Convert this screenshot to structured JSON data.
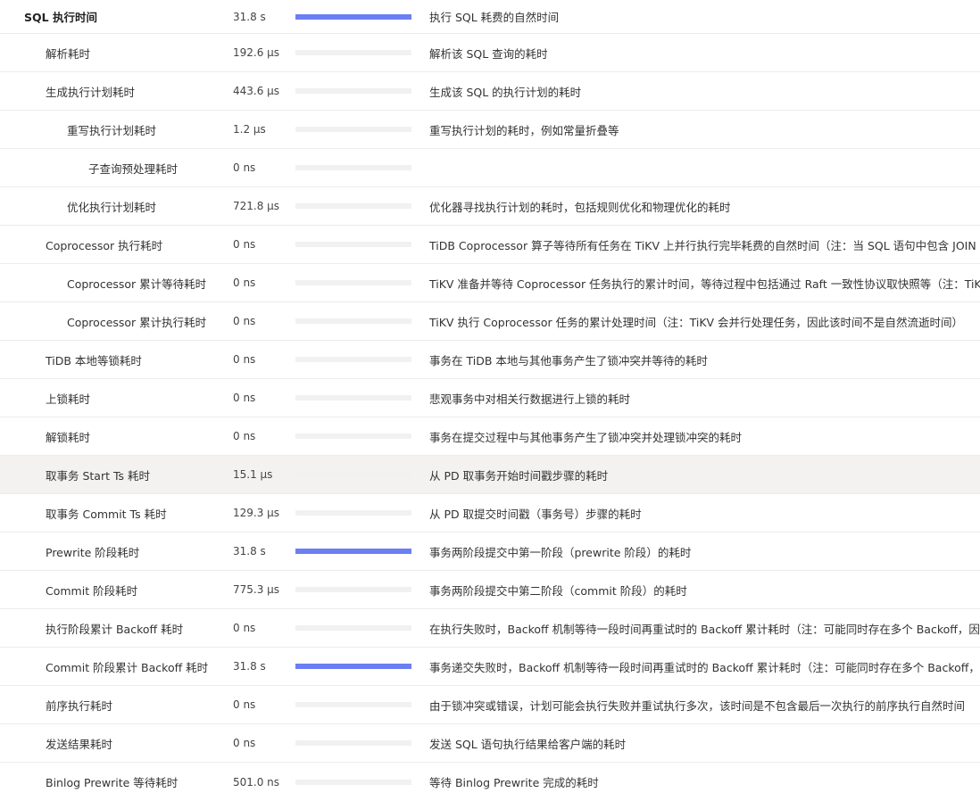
{
  "bar_color": "#6b7ff3",
  "track_color": "#f1f1f1",
  "highlight_color": "#f3f2f1",
  "rows": [
    {
      "name": "SQL 执行时间",
      "indent": 0,
      "value": "31.8 s",
      "fill": 1.0,
      "desc": "执行 SQL 耗费的自然时间"
    },
    {
      "name": "解析耗时",
      "indent": 1,
      "value": "192.6 µs",
      "fill": 0.0,
      "desc": "解析该 SQL 查询的耗时"
    },
    {
      "name": "生成执行计划耗时",
      "indent": 1,
      "value": "443.6 µs",
      "fill": 0.0,
      "desc": "生成该 SQL 的执行计划的耗时"
    },
    {
      "name": "重写执行计划耗时",
      "indent": 2,
      "value": "1.2 µs",
      "fill": 0.0,
      "desc": "重写执行计划的耗时，例如常量折叠等"
    },
    {
      "name": "子查询预处理耗时",
      "indent": 3,
      "value": "0 ns",
      "fill": 0.0,
      "desc": ""
    },
    {
      "name": "优化执行计划耗时",
      "indent": 2,
      "value": "721.8 µs",
      "fill": 0.0,
      "desc": "优化器寻找执行计划的耗时，包括规则优化和物理优化的耗时"
    },
    {
      "name": "Coprocessor 执行耗时",
      "indent": 1,
      "value": "0 ns",
      "fill": 0.0,
      "desc": "TiDB Coprocessor 算子等待所有任务在 TiKV 上并行执行完毕耗费的自然时间（注：当 SQL 语句中包含 JOIN 时"
    },
    {
      "name": "Coprocessor 累计等待耗时",
      "indent": 2,
      "value": "0 ns",
      "fill": 0.0,
      "desc": "TiKV 准备并等待 Coprocessor 任务执行的累计时间，等待过程中包括通过 Raft 一致性协议取快照等（注：TiKV"
    },
    {
      "name": "Coprocessor 累计执行耗时",
      "indent": 2,
      "value": "0 ns",
      "fill": 0.0,
      "desc": "TiKV 执行 Coprocessor 任务的累计处理时间（注：TiKV 会并行处理任务，因此该时间不是自然流逝时间）"
    },
    {
      "name": "TiDB 本地等锁耗时",
      "indent": 1,
      "value": "0 ns",
      "fill": 0.0,
      "desc": "事务在 TiDB 本地与其他事务产生了锁冲突并等待的耗时"
    },
    {
      "name": "上锁耗时",
      "indent": 1,
      "value": "0 ns",
      "fill": 0.0,
      "desc": "悲观事务中对相关行数据进行上锁的耗时"
    },
    {
      "name": "解锁耗时",
      "indent": 1,
      "value": "0 ns",
      "fill": 0.0,
      "desc": "事务在提交过程中与其他事务产生了锁冲突并处理锁冲突的耗时"
    },
    {
      "name": "取事务 Start Ts 耗时",
      "indent": 1,
      "value": "15.1 µs",
      "fill": 0.0,
      "desc": "从 PD 取事务开始时间戳步骤的耗时",
      "highlight": true
    },
    {
      "name": "取事务 Commit Ts 耗时",
      "indent": 1,
      "value": "129.3 µs",
      "fill": 0.0,
      "desc": "从 PD 取提交时间戳（事务号）步骤的耗时"
    },
    {
      "name": "Prewrite 阶段耗时",
      "indent": 1,
      "value": "31.8 s",
      "fill": 1.0,
      "desc": "事务两阶段提交中第一阶段（prewrite 阶段）的耗时"
    },
    {
      "name": "Commit 阶段耗时",
      "indent": 1,
      "value": "775.3 µs",
      "fill": 0.0,
      "desc": "事务两阶段提交中第二阶段（commit 阶段）的耗时"
    },
    {
      "name": "执行阶段累计 Backoff 耗时",
      "indent": 1,
      "value": "0 ns",
      "fill": 0.0,
      "desc": "在执行失败时，Backoff 机制等待一段时间再重试时的 Backoff 累计耗时（注：可能同时存在多个 Backoff，因此"
    },
    {
      "name": "Commit 阶段累计 Backoff 耗时",
      "indent": 1,
      "value": "31.8 s",
      "fill": 1.0,
      "desc": "事务递交失败时，Backoff 机制等待一段时间再重试时的 Backoff 累计耗时（注：可能同时存在多个 Backoff，因"
    },
    {
      "name": "前序执行耗时",
      "indent": 1,
      "value": "0 ns",
      "fill": 0.0,
      "desc": "由于锁冲突或错误，计划可能会执行失败并重试执行多次，该时间是不包含最后一次执行的前序执行自然时间"
    },
    {
      "name": "发送结果耗时",
      "indent": 1,
      "value": "0 ns",
      "fill": 0.0,
      "desc": "发送 SQL 语句执行结果给客户端的耗时"
    },
    {
      "name": "Binlog Prewrite 等待耗时",
      "indent": 1,
      "value": "501.0 ns",
      "fill": 0.0,
      "desc": "等待 Binlog Prewrite 完成的耗时"
    }
  ]
}
